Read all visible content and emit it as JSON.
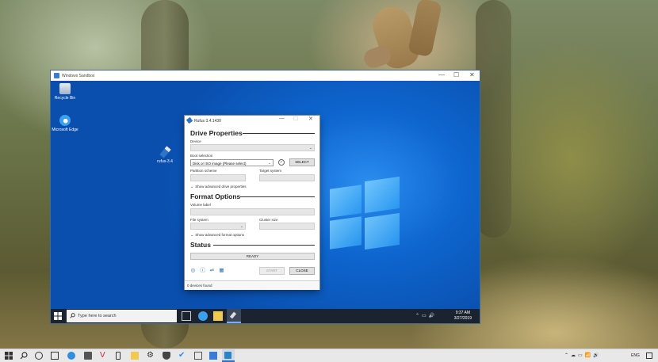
{
  "sandbox": {
    "title": "Windows Sandbox",
    "controls": {
      "minimize": "—",
      "maximize": "☐",
      "close": "✕"
    }
  },
  "desktop_icons": [
    {
      "label": "Recycle Bin",
      "icon": "recycle-bin-icon"
    },
    {
      "label": "Microsoft Edge",
      "icon": "edge-icon"
    },
    {
      "label": "rufus-3.4",
      "icon": "usb-drive-icon"
    }
  ],
  "sandbox_taskbar": {
    "search_placeholder": "Type here to search",
    "time": "9:37 AM",
    "date": "3/27/2019"
  },
  "rufus": {
    "title": "Rufus 3.4.1430",
    "drive_properties": {
      "header": "Drive Properties",
      "device_label": "Device",
      "device_value": "",
      "boot_selection_label": "Boot selection",
      "boot_selection_value": "Disk or ISO image (Please select)",
      "select_button": "SELECT",
      "partition_scheme_label": "Partition scheme",
      "target_system_label": "Target system",
      "advanced_toggle": "Show advanced drive properties"
    },
    "format_options": {
      "header": "Format Options",
      "volume_label_label": "Volume label",
      "file_system_label": "File system",
      "cluster_size_label": "Cluster size",
      "advanced_toggle": "Show advanced format options"
    },
    "status": {
      "header": "Status",
      "progress_text": "READY",
      "progress_fraction": 0
    },
    "buttons": {
      "start": "START",
      "close": "CLOSE"
    },
    "status_bar": "0 devices found",
    "tool_icons": [
      "globe-icon",
      "info-icon",
      "settings-icon",
      "log-icon"
    ]
  },
  "host_taskbar": {
    "language": "ENG",
    "colors": {
      "background": "#e8e8e8"
    }
  },
  "colors": {
    "sandbox_desktop": "#0e66cf",
    "sandbox_taskbar": "#1b2330",
    "accent": "#2e75c6"
  }
}
